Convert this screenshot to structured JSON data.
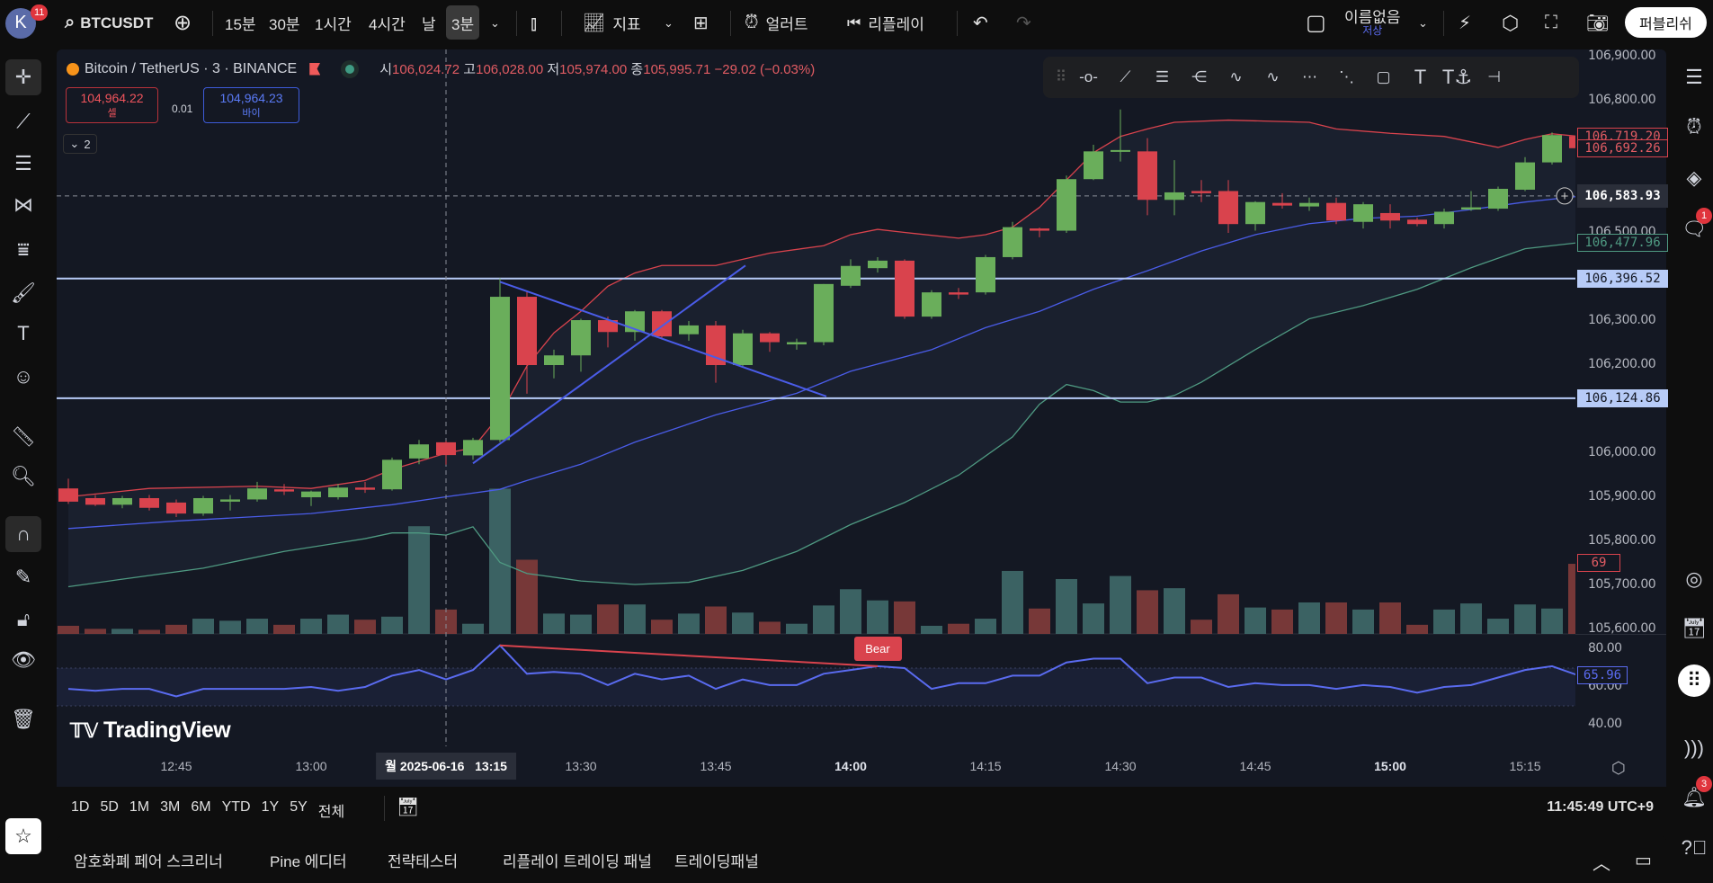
{
  "topbar": {
    "avatar_letter": "K",
    "avatar_badge": "11",
    "symbol": "BTCUSDT",
    "intervals": [
      "15분",
      "30분",
      "1시간",
      "4시간",
      "날",
      "3분"
    ],
    "indicators_label": "지표",
    "alert_label": "얼러트",
    "replay_label": "리플레이",
    "layout_name": "이름없음",
    "layout_status": "저상",
    "publish_label": "퍼블리쉬"
  },
  "legend": {
    "title": "Bitcoin / TetherUS · 3 · BINANCE",
    "o_label": "시",
    "o": "106,024.72",
    "h_label": "고",
    "h": "106,028.00",
    "l_label": "저",
    "l": "105,974.00",
    "c_label": "종",
    "c": "105,995.71",
    "change": "−29.02 (−0.03%)",
    "sell_price": "104,964.22",
    "sell_label": "셀",
    "spread": "0.01",
    "buy_price": "104,964.23",
    "buy_label": "바이",
    "indicators_count": "2"
  },
  "price_axis": {
    "ticks": [
      "106,900.00",
      "106,800.00",
      "106,500.00",
      "106,300.00",
      "106,200.00",
      "106,000.00",
      "105,900.00",
      "105,800.00",
      "105,700.00",
      "105,600.00"
    ],
    "tick_values": [
      106900,
      106800,
      106500,
      106300,
      106200,
      106000,
      105900,
      105800,
      105700,
      105600
    ],
    "labels": [
      {
        "text": "106,719.20",
        "value": 106719.2,
        "kind": "upper"
      },
      {
        "text": "106,692.26",
        "value": 106692.26,
        "kind": "last"
      },
      {
        "text": "106,583.93",
        "value": 106583.93,
        "kind": "crosshair"
      },
      {
        "text": "106,477.96",
        "value": 106477.96,
        "kind": "lower"
      },
      {
        "text": "106,396.52",
        "value": 106396.52,
        "kind": "hline"
      },
      {
        "text": "106,124.86",
        "value": 106124.86,
        "kind": "hline"
      }
    ],
    "volume_label": "69",
    "rsi_ticks": [
      "80.00",
      "60.00",
      "40.00"
    ],
    "rsi_tick_values": [
      80,
      60,
      40
    ],
    "rsi_label": "65.96"
  },
  "time_axis": {
    "ticks": [
      {
        "t": "12:45",
        "i": 4
      },
      {
        "t": "13:00",
        "i": 9
      },
      {
        "t": "13:30",
        "i": 19
      },
      {
        "t": "13:45",
        "i": 24
      },
      {
        "t": "14:00",
        "i": 29,
        "bold": true
      },
      {
        "t": "14:15",
        "i": 34
      },
      {
        "t": "14:30",
        "i": 39
      },
      {
        "t": "14:45",
        "i": 44
      },
      {
        "t": "15:00",
        "i": 49,
        "bold": true
      },
      {
        "t": "15:15",
        "i": 54
      }
    ],
    "crosshair_label": "월 2025-06-16   13:15"
  },
  "chart_data": {
    "type": "candlestick",
    "interval": "3m",
    "x_start": "12:33",
    "candles_ohlc": [
      [
        105920,
        105942,
        105885,
        105890
      ],
      [
        105898,
        105905,
        105880,
        105883
      ],
      [
        105883,
        105903,
        105875,
        105898
      ],
      [
        105898,
        105905,
        105870,
        105876
      ],
      [
        105888,
        105895,
        105855,
        105863
      ],
      [
        105863,
        105903,
        105858,
        105898
      ],
      [
        105890,
        105905,
        105870,
        105895
      ],
      [
        105895,
        105935,
        105890,
        105920
      ],
      [
        105918,
        105930,
        105905,
        105913
      ],
      [
        105900,
        105915,
        105880,
        105913
      ],
      [
        105900,
        105930,
        105895,
        105922
      ],
      [
        105922,
        105935,
        105910,
        105917
      ],
      [
        105918,
        105990,
        105915,
        105985
      ],
      [
        105988,
        106030,
        105975,
        106020
      ],
      [
        106024.72,
        106028,
        105974,
        105995.71
      ],
      [
        105995,
        106035,
        105985,
        106030
      ],
      [
        106030,
        106397,
        106025,
        106355
      ],
      [
        106355,
        106368,
        106135,
        106200
      ],
      [
        106200,
        106235,
        106170,
        106222
      ],
      [
        106222,
        106305,
        106185,
        106302
      ],
      [
        106302,
        106310,
        106240,
        106275
      ],
      [
        106275,
        106325,
        106255,
        106322
      ],
      [
        106322,
        106325,
        106260,
        106265
      ],
      [
        106270,
        106300,
        106255,
        106290
      ],
      [
        106290,
        106300,
        106160,
        106200
      ],
      [
        106200,
        106280,
        106195,
        106272
      ],
      [
        106272,
        106275,
        106230,
        106252
      ],
      [
        106247,
        106260,
        106235,
        106252
      ],
      [
        106252,
        106384,
        106245,
        106384
      ],
      [
        106380,
        106440,
        106375,
        106425
      ],
      [
        106420,
        106445,
        106410,
        106437
      ],
      [
        106437,
        106440,
        106305,
        106310
      ],
      [
        106310,
        106370,
        106305,
        106365
      ],
      [
        106365,
        106375,
        106350,
        106360
      ],
      [
        106365,
        106450,
        106360,
        106445
      ],
      [
        106445,
        106525,
        106440,
        106513
      ],
      [
        106510,
        106512,
        106490,
        106505
      ],
      [
        106505,
        106630,
        106500,
        106622
      ],
      [
        106622,
        106700,
        106620,
        106685
      ],
      [
        106685,
        106780,
        106662,
        106688
      ],
      [
        106685,
        106715,
        106540,
        106575
      ],
      [
        106575,
        106665,
        106540,
        106592
      ],
      [
        106595,
        106620,
        106570,
        106590
      ],
      [
        106595,
        106620,
        106500,
        106520
      ],
      [
        106520,
        106572,
        106505,
        106570
      ],
      [
        106568,
        106590,
        106555,
        106562
      ],
      [
        106560,
        106580,
        106550,
        106568
      ],
      [
        106568,
        106580,
        106520,
        106528
      ],
      [
        106525,
        106570,
        106510,
        106565
      ],
      [
        106545,
        106565,
        106510,
        106528
      ],
      [
        106530,
        106535,
        106515,
        106520
      ],
      [
        106520,
        106555,
        106510,
        106548
      ],
      [
        106553,
        106595,
        106550,
        106558
      ],
      [
        106555,
        106605,
        106550,
        106600
      ],
      [
        106598,
        106672,
        106595,
        106660
      ],
      [
        106660,
        106728,
        106655,
        106722
      ],
      [
        106719.2,
        106725,
        106680,
        106692.26
      ]
    ],
    "volume": [
      8,
      5,
      5,
      4,
      9,
      15,
      13,
      15,
      9,
      15,
      19,
      14,
      17,
      106,
      24,
      10,
      143,
      73,
      20,
      19,
      29,
      29,
      14,
      20,
      27,
      21,
      12,
      10,
      28,
      44,
      33,
      32,
      8,
      10,
      15,
      62,
      25,
      54,
      30,
      57,
      43,
      45,
      14,
      39,
      26,
      24,
      31,
      31,
      24,
      31,
      9,
      24,
      30,
      15,
      29,
      25,
      69
    ],
    "bollinger": {
      "upper": [
        [
          1,
          105901
        ],
        [
          4,
          105920
        ],
        [
          8,
          105925
        ],
        [
          10,
          105920
        ],
        [
          12,
          105938
        ],
        [
          13,
          105963
        ],
        [
          15,
          106000
        ],
        [
          16,
          106012
        ],
        [
          17,
          106087
        ],
        [
          18,
          106198
        ],
        [
          19,
          106273
        ],
        [
          20,
          106322
        ],
        [
          21,
          106379
        ],
        [
          22,
          106409
        ],
        [
          23,
          106426
        ],
        [
          25,
          106426
        ],
        [
          27,
          106454
        ],
        [
          29,
          106471
        ],
        [
          30,
          106496
        ],
        [
          31,
          106508
        ],
        [
          32,
          106501
        ],
        [
          34,
          106488
        ],
        [
          35,
          106496
        ],
        [
          36,
          106513
        ],
        [
          37,
          106558
        ],
        [
          38,
          106620
        ],
        [
          39,
          106682
        ],
        [
          40,
          106719
        ],
        [
          41,
          106736
        ],
        [
          42,
          106751
        ],
        [
          44,
          106756
        ],
        [
          47,
          106751
        ],
        [
          48,
          106736
        ],
        [
          50,
          106726
        ],
        [
          52,
          106719
        ],
        [
          54,
          106694
        ],
        [
          55,
          106712
        ],
        [
          56,
          106725
        ],
        [
          57,
          106719
        ]
      ],
      "basis": [
        [
          1,
          105829
        ],
        [
          5,
          105846
        ],
        [
          10,
          105863
        ],
        [
          13,
          105883
        ],
        [
          15,
          105901
        ],
        [
          17,
          105918
        ],
        [
          18,
          105938
        ],
        [
          20,
          105975
        ],
        [
          22,
          106025
        ],
        [
          25,
          106087
        ],
        [
          28,
          106136
        ],
        [
          30,
          106186
        ],
        [
          33,
          106235
        ],
        [
          35,
          106285
        ],
        [
          37,
          106322
        ],
        [
          39,
          106372
        ],
        [
          41,
          106414
        ],
        [
          43,
          106459
        ],
        [
          45,
          106496
        ],
        [
          47,
          106521
        ],
        [
          49,
          106533
        ],
        [
          51,
          106538
        ],
        [
          53,
          106553
        ],
        [
          55,
          106570
        ],
        [
          57,
          106583
        ]
      ],
      "lower": [
        [
          1,
          105697
        ],
        [
          3,
          105714
        ],
        [
          6,
          105739
        ],
        [
          9,
          105777
        ],
        [
          12,
          105806
        ],
        [
          13,
          105819
        ],
        [
          14,
          105819
        ],
        [
          15,
          105814
        ],
        [
          16,
          105833
        ],
        [
          17,
          105752
        ],
        [
          18,
          105727
        ],
        [
          20,
          105710
        ],
        [
          22,
          105702
        ],
        [
          24,
          105707
        ],
        [
          26,
          105734
        ],
        [
          28,
          105777
        ],
        [
          30,
          105838
        ],
        [
          32,
          105888
        ],
        [
          34,
          105950
        ],
        [
          36,
          106037
        ],
        [
          37,
          106111
        ],
        [
          38,
          106156
        ],
        [
          39,
          106142
        ],
        [
          40,
          106116
        ],
        [
          41,
          106116
        ],
        [
          42,
          106131
        ],
        [
          43,
          106161
        ],
        [
          45,
          106235
        ],
        [
          47,
          106305
        ],
        [
          49,
          106335
        ],
        [
          51,
          106372
        ],
        [
          53,
          106421
        ],
        [
          55,
          106464
        ],
        [
          57,
          106478
        ]
      ]
    },
    "rsi": [
      59,
      58,
      59,
      59,
      55,
      59,
      59,
      59,
      59,
      60,
      58,
      60,
      66,
      69,
      64,
      69,
      82,
      67,
      68,
      67,
      61,
      67,
      64,
      66,
      59,
      64,
      61,
      61,
      67,
      69,
      71,
      70,
      59,
      62,
      62,
      66,
      66,
      73,
      75,
      75,
      62,
      65,
      65,
      60,
      62,
      61,
      61,
      59,
      61,
      60,
      57,
      60,
      61,
      65,
      69,
      71,
      66
    ],
    "rsi_band": [
      50,
      70
    ],
    "drawings": {
      "hlines": [
        106396.52,
        106124.86
      ],
      "trendlines": [
        [
          [
            16,
            106389
          ],
          [
            28.1,
            106129
          ]
        ],
        [
          [
            15,
            105977
          ],
          [
            25.1,
            106426
          ]
        ]
      ],
      "rsi_divergence": {
        "from": [
          16,
          82
        ],
        "to": [
          30,
          71
        ],
        "label": "Bear"
      }
    },
    "crosshair": {
      "index": 14,
      "price": 106583.93
    }
  },
  "branding": {
    "logo": "TradingView"
  },
  "bottom": {
    "ranges": [
      "1D",
      "5D",
      "1M",
      "3M",
      "6M",
      "YTD",
      "1Y",
      "5Y",
      "전체"
    ],
    "clock": "11:45:49 UTC+9",
    "tabs": [
      "암호화폐 페어 스크리너",
      "Pine 에디터",
      "전략테스터",
      "리플레이 트레이딩 패널",
      "트레이딩패널"
    ]
  },
  "rightbar": {
    "chat_badge": "1",
    "notif_badge": "3"
  },
  "colors": {
    "up": "#6aae5b",
    "down": "#d9434d",
    "vol_up": "#3b6263",
    "vol_down": "#773838",
    "upper": "#d9434d",
    "basis": "#4a5ce8",
    "lower": "#4f9a82",
    "hline": "#b7cbf7",
    "rsi": "#5a6bf0",
    "bg": "#141823"
  }
}
